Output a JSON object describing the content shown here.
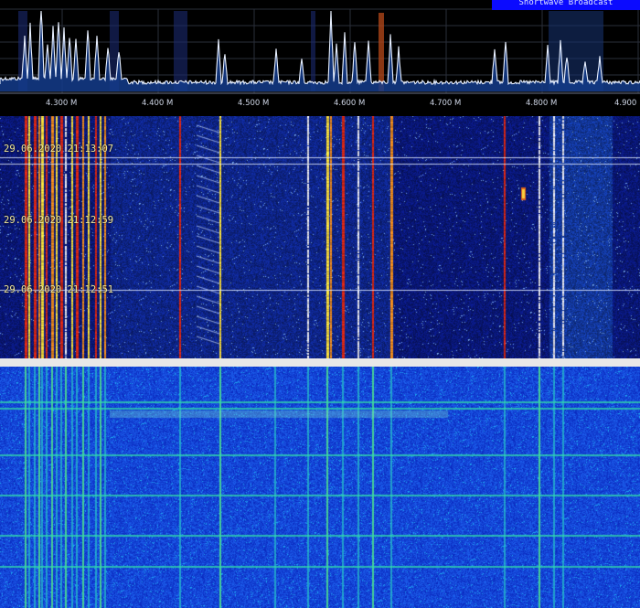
{
  "header": {
    "mode_badge_label": "Shortwave Broadcast"
  },
  "spectrum": {
    "freq_ticks": [
      "4.300 M",
      "4.400 M",
      "4.500 M",
      "4.600 M",
      "4.700 M",
      "4.800 M",
      "4.900"
    ]
  },
  "waterfall": {
    "timestamps": [
      "29.06.2020 21:13:07",
      "29.06.2020 21:12:59",
      "29.06.2020 21:12:51"
    ]
  },
  "colors": {
    "spectrum_line": "#e8f0ff",
    "spectrum_fill": "#143c8c",
    "marker": "#b84a1a",
    "waterfall_top_bg": "#0a1a8a",
    "waterfall_bottom_bg": "#0a2fd0",
    "badge": "#0b0bff"
  }
}
